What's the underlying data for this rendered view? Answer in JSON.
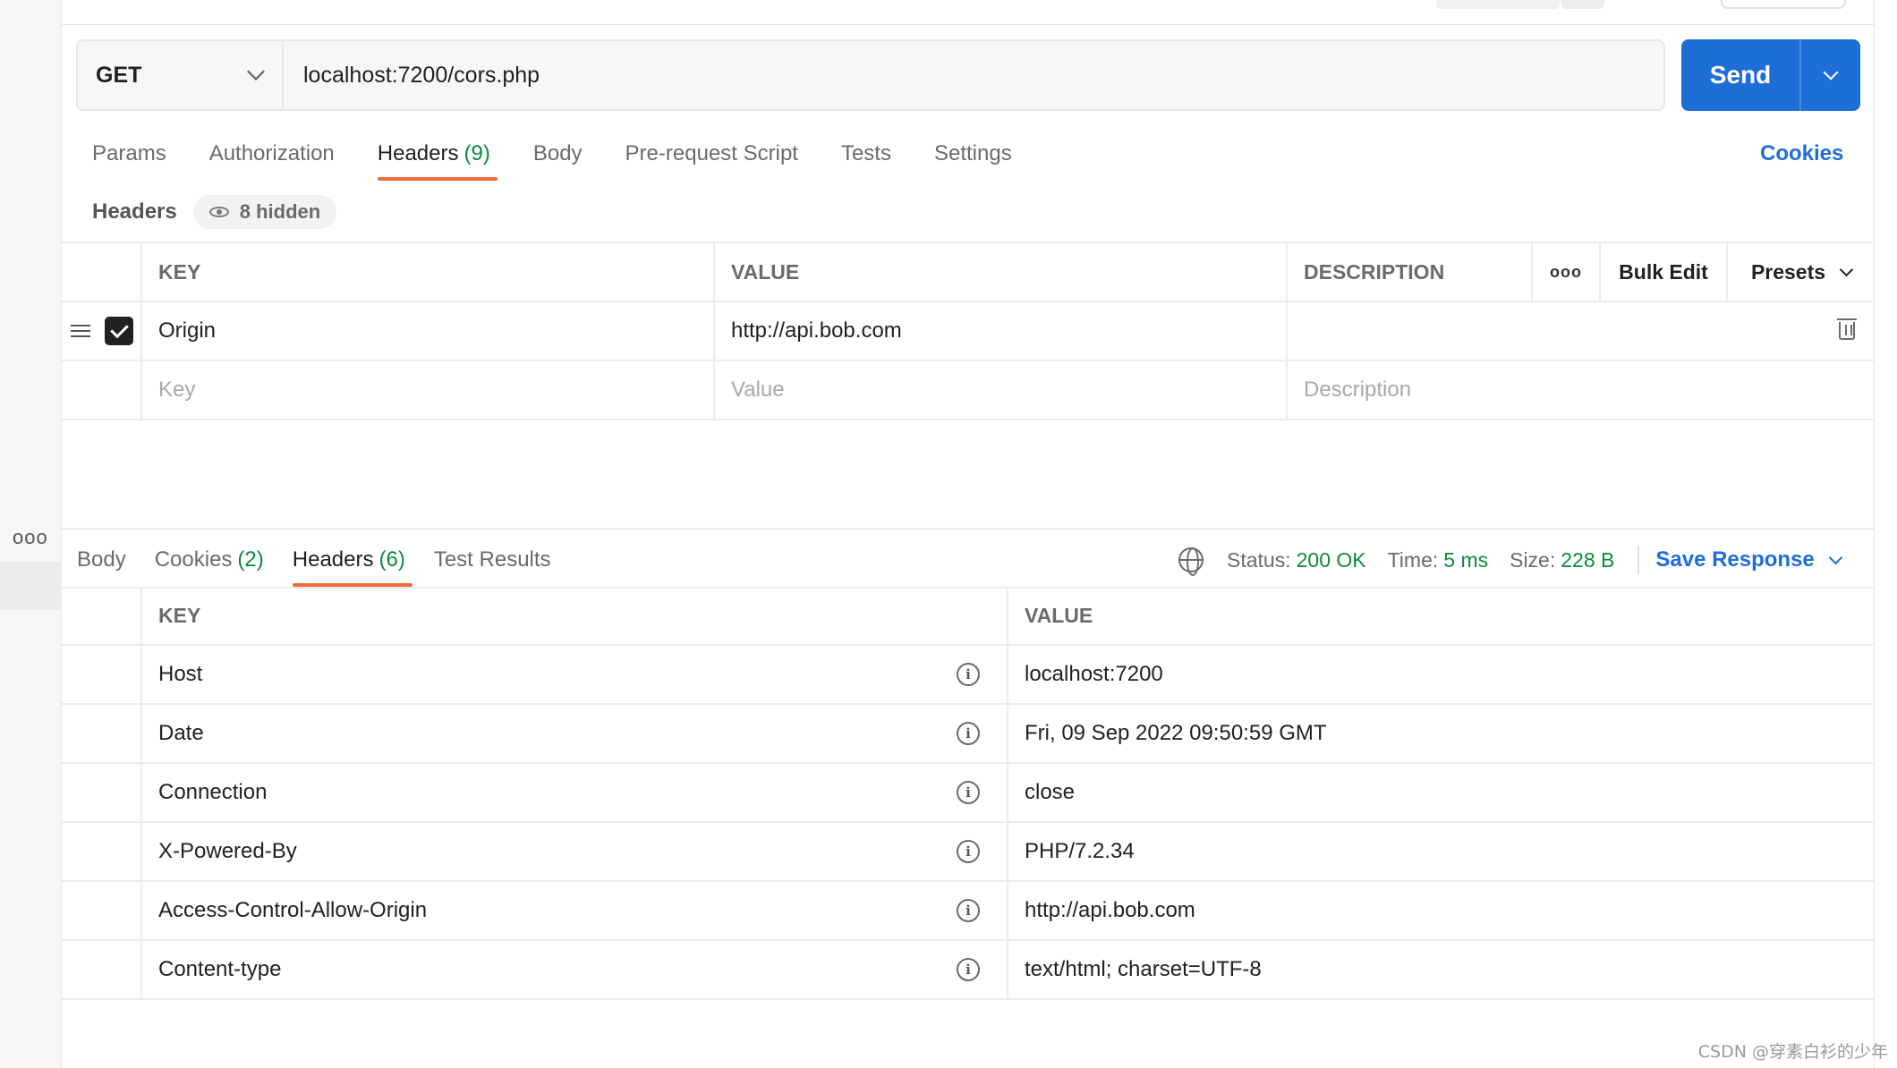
{
  "request": {
    "method": "GET",
    "url": "localhost:7200/cors.php",
    "send_label": "Send"
  },
  "request_tabs": [
    {
      "label": "Params",
      "count": ""
    },
    {
      "label": "Authorization",
      "count": ""
    },
    {
      "label": "Headers",
      "count": "(9)",
      "active": true
    },
    {
      "label": "Body",
      "count": ""
    },
    {
      "label": "Pre-request Script",
      "count": ""
    },
    {
      "label": "Tests",
      "count": ""
    },
    {
      "label": "Settings",
      "count": ""
    }
  ],
  "cookies_link": "Cookies",
  "headers_section": {
    "title": "Headers",
    "hidden_label": "8 hidden"
  },
  "request_headers_table": {
    "columns": {
      "key": "KEY",
      "value": "VALUE",
      "description": "DESCRIPTION",
      "bulk_edit": "Bulk Edit",
      "presets": "Presets"
    },
    "rows": [
      {
        "key": "Origin",
        "value": "http://api.bob.com",
        "description": "",
        "checked": true
      }
    ],
    "placeholders": {
      "key": "Key",
      "value": "Value",
      "description": "Description"
    }
  },
  "response_tabs": [
    {
      "label": "Body",
      "count": ""
    },
    {
      "label": "Cookies",
      "count": "(2)"
    },
    {
      "label": "Headers",
      "count": "(6)",
      "active": true
    },
    {
      "label": "Test Results",
      "count": ""
    }
  ],
  "response_status": {
    "status_label": "Status:",
    "status_value": "200 OK",
    "time_label": "Time:",
    "time_value": "5 ms",
    "size_label": "Size:",
    "size_value": "228 B",
    "save_response": "Save Response",
    "status_color": "#0d8a3b"
  },
  "response_headers_table": {
    "columns": {
      "key": "KEY",
      "value": "VALUE"
    },
    "rows": [
      {
        "key": "Host",
        "value": "localhost:7200"
      },
      {
        "key": "Date",
        "value": "Fri, 09 Sep 2022 09:50:59 GMT"
      },
      {
        "key": "Connection",
        "value": "close"
      },
      {
        "key": "X-Powered-By",
        "value": "PHP/7.2.34"
      },
      {
        "key": "Access-Control-Allow-Origin",
        "value": "http://api.bob.com"
      },
      {
        "key": "Content-type",
        "value": "text/html; charset=UTF-8"
      }
    ]
  },
  "watermark": "CSDN @穿素白衫的少年",
  "colors": {
    "accent": "#1e6ed8",
    "active_tab_underline": "#f26b3a",
    "count_green": "#0d8a3b"
  },
  "icons": [
    "more-icon",
    "chevron-down-icon",
    "drag-handle-icon",
    "checkbox-icon",
    "trash-icon",
    "eye-icon",
    "globe-icon",
    "info-icon"
  ]
}
